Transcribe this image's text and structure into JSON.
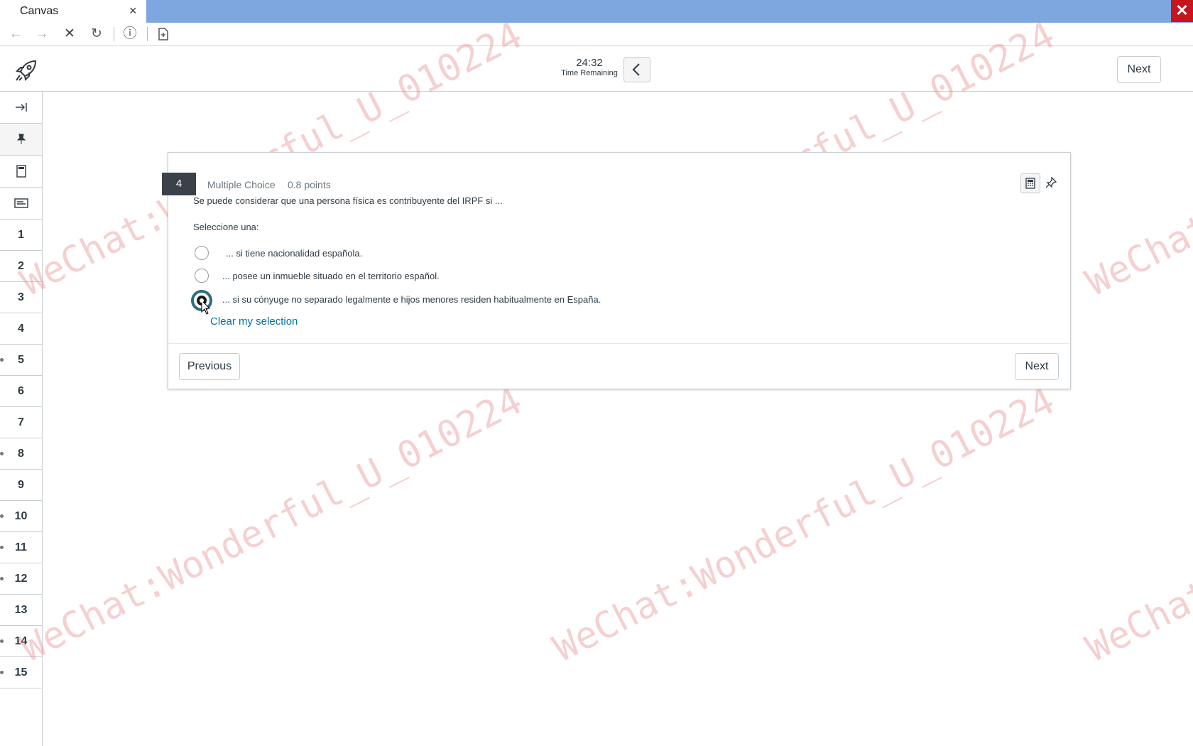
{
  "browser": {
    "tab_title": "Canvas",
    "tab_close": "×",
    "window_close": "✕",
    "nav": {
      "back": "←",
      "forward": "→",
      "stop": "✕",
      "reload": "↻",
      "info": "ⓘ",
      "page": "▯"
    }
  },
  "header": {
    "timer_value": "24:32",
    "timer_label": "Time Remaining",
    "next_label": "Next",
    "logo_icon": "rocket-icon"
  },
  "sidebar": {
    "tools": [
      {
        "icon": "expand-icon",
        "glyph": "⇥"
      },
      {
        "icon": "pin-icon",
        "glyph": "📌"
      },
      {
        "icon": "calculator-icon",
        "glyph": "▭"
      },
      {
        "icon": "notes-icon",
        "glyph": "▤"
      }
    ],
    "questions": [
      "1",
      "2",
      "3",
      "4",
      "5",
      "6",
      "7",
      "8",
      "9",
      "10",
      "11",
      "12",
      "13",
      "14",
      "15"
    ],
    "answered_dots": [
      "5",
      "8",
      "10",
      "11",
      "12",
      "14",
      "15"
    ]
  },
  "question": {
    "number": "4",
    "type": "Multiple Choice",
    "points": "0.8 points",
    "text": "Se puede considerar que una persona física es contribuyente del IRPF si ...",
    "prompt": "Seleccione una:",
    "options": [
      "... si tiene nacionalidad española.",
      "... posee un inmueble situado en el territorio español.",
      "... si su cónyuge no separado legalmente e hijos menores residen habitualmente en España."
    ],
    "selected_index": 2,
    "clear_label": "Clear my selection",
    "previous_label": "Previous",
    "next_label": "Next"
  },
  "watermark": {
    "text": "WeChat:Wonderful_U_010224"
  },
  "colors": {
    "tabbar": "#7ea7e0",
    "window_close": "#c8141e",
    "link": "#0770a3",
    "badge": "#3b4149"
  }
}
